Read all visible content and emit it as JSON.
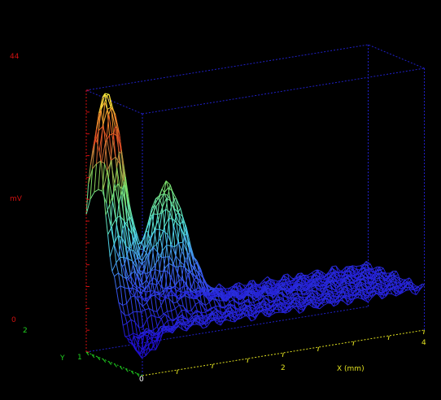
{
  "chart_data": {
    "type": "surface3d-wireframe",
    "zlabel": "mV",
    "xlabel": "X (mm)",
    "ylabel": "Y",
    "zlim": [
      0,
      44
    ],
    "xlim": [
      0,
      4
    ],
    "ylim": [
      0,
      2
    ],
    "z_tick_labels": [
      "0",
      "44"
    ],
    "x_tick_labels": [
      "0",
      "2",
      "4"
    ],
    "y_tick_labels": [
      "1",
      "2"
    ],
    "peak": {
      "x": 0.15,
      "y": 1.65,
      "z": 44
    },
    "secondary_peak": {
      "x": 0.85,
      "y": 1.3,
      "z": 34
    },
    "background_level_mV": 7,
    "colormap": [
      "#2010d0",
      "#3a60f0",
      "#50e0e0",
      "#80e060",
      "#e04020",
      "#ffff40"
    ],
    "box_color": "#2020c8",
    "z_axis_color": "#d01010",
    "x_axis_color": "#e0e020",
    "y_axis_color": "#20d020",
    "grid": false
  }
}
